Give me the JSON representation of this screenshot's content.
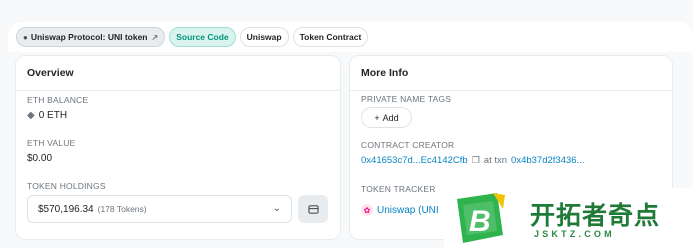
{
  "header": {
    "chips": [
      {
        "label": "Uniswap Protocol: UNI token",
        "icon": "tag-icon",
        "ext": "external-link-icon"
      },
      {
        "label": "Source Code"
      },
      {
        "label": "Uniswap"
      },
      {
        "label": "Token Contract"
      }
    ]
  },
  "overview": {
    "title": "Overview",
    "eth_balance_label": "ETH BALANCE",
    "eth_balance_value": "0 ETH",
    "eth_value_label": "ETH VALUE",
    "eth_value_value": "$0.00",
    "token_holdings_label": "TOKEN HOLDINGS",
    "token_holdings_amount": "$570,196.34",
    "token_holdings_count": "(178 Tokens)"
  },
  "more_info": {
    "title": "More Info",
    "private_tags_label": "PRIVATE NAME TAGS",
    "add_label": "Add",
    "creator_label": "CONTRACT CREATOR",
    "creator_address": "0x41653c7d...Ec4142Cfb",
    "at_txn": "at txn",
    "txn_hash": "0x4b37d2f3436...",
    "tracker_label": "TOKEN TRACKER",
    "tracker_value": "Uniswap (UNI"
  },
  "watermark": {
    "text": "开拓者奇点",
    "url": "JSKTZ.COM"
  },
  "colors": {
    "accent_green": "#00967b",
    "link_blue": "#0784c3",
    "uni_pink": "#ff007a"
  }
}
